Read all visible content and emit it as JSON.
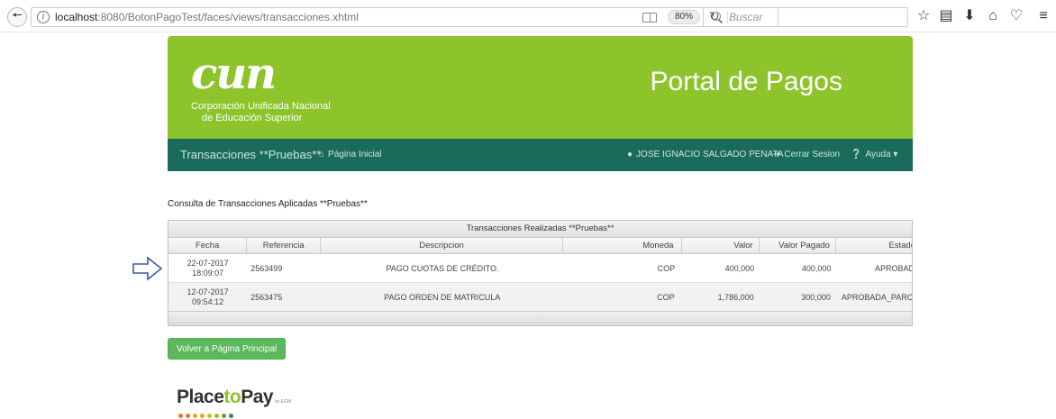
{
  "browser": {
    "url_host": "localhost",
    "url_path": ":8080/BotonPagoTest/faces/views/transacciones.xhtml",
    "zoom": "80%",
    "search_placeholder": "Buscar",
    "icons": [
      "back-icon",
      "info-icon",
      "reader-view-icon",
      "reload-icon",
      "search-icon",
      "bookmark-star-icon",
      "bookmarks-list-icon",
      "download-icon",
      "home-icon",
      "pocket-icon",
      "menu-icon"
    ]
  },
  "header": {
    "logo": "cun",
    "logo_line1": "Corporación Unificada Nacional",
    "logo_line2": "de Educación Superior",
    "title": "Portal de Pagos",
    "color": "#8dc42c"
  },
  "nav": {
    "brand": "Transacciones **Pruebas**",
    "home": "Página Inicial",
    "user": "JOSE IGNACIO SALGADO PENATA",
    "logout": "Cerrar Sesion",
    "help": "Ayuda",
    "color": "#1a6b5c"
  },
  "content": {
    "title": "Consulta de Transacciones Aplicadas **Pruebas**"
  },
  "grid": {
    "caption": "Transacciones Realizadas **Pruebas**",
    "columns": [
      "Fecha",
      "Referencia",
      "Descripcion",
      "Moneda",
      "Valor",
      "Valor Pagado",
      "Estado"
    ],
    "rows": [
      {
        "fecha_date": "22-07-2017",
        "fecha_time": "18:09:07",
        "referencia": "2563499",
        "descripcion": "PAGO CUOTAS DE CRÉDITO.",
        "moneda": "COP",
        "valor": "400,000",
        "valor_pagado": "400,000",
        "estado": "APROBADA"
      },
      {
        "fecha_date": "12-07-2017",
        "fecha_time": "09:54:12",
        "referencia": "2563475",
        "descripcion": "PAGO ORDEN DE MATRICULA",
        "moneda": "COP",
        "valor": "1,786,000",
        "valor_pagado": "300,000",
        "estado": "APROBADA_PARCIAL"
      }
    ]
  },
  "actions": {
    "back_to_main": "Volver a Página Principal",
    "color": "#5cb85c"
  },
  "footer_logo": {
    "place": "Place",
    "to": "to",
    "pay": "Pay",
    "small": "by EGM",
    "dot_colors": [
      "#e8732a",
      "#e8732a",
      "#f0a020",
      "#f0a020",
      "#b7c530",
      "#8dc42c",
      "#5aa63c",
      "#2f8f4e"
    ]
  }
}
